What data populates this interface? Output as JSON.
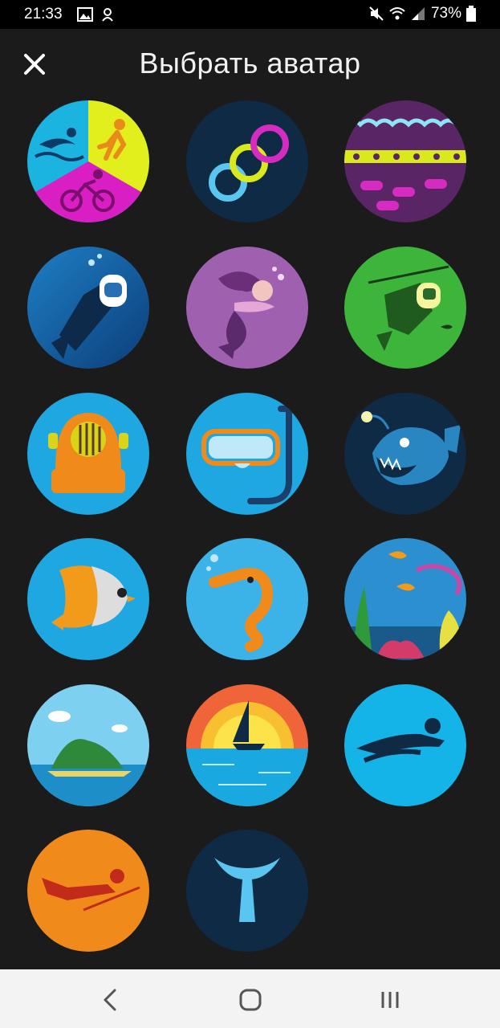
{
  "status_bar": {
    "time": "21:33",
    "battery_percent": "73%",
    "icons": [
      "gallery-icon",
      "sync-icon",
      "mute-icon",
      "wifi-icon",
      "signal-icon",
      "battery-icon"
    ]
  },
  "header": {
    "title": "Выбрать аватар",
    "close_icon": "close-icon"
  },
  "avatars": [
    {
      "name": "triathlon"
    },
    {
      "name": "rings"
    },
    {
      "name": "wave-stripes"
    },
    {
      "name": "scuba-diver"
    },
    {
      "name": "mermaid"
    },
    {
      "name": "spearfisher"
    },
    {
      "name": "diving-helmet"
    },
    {
      "name": "mask-snorkel"
    },
    {
      "name": "anglerfish"
    },
    {
      "name": "butterflyfish"
    },
    {
      "name": "seahorse"
    },
    {
      "name": "coral-reef"
    },
    {
      "name": "island"
    },
    {
      "name": "sunset-sailboat"
    },
    {
      "name": "swimmer-pictogram"
    },
    {
      "name": "diver-pictogram"
    },
    {
      "name": "whale-tail"
    }
  ],
  "nav_bar": {
    "icons": [
      "back-icon",
      "home-icon",
      "recents-icon"
    ]
  }
}
